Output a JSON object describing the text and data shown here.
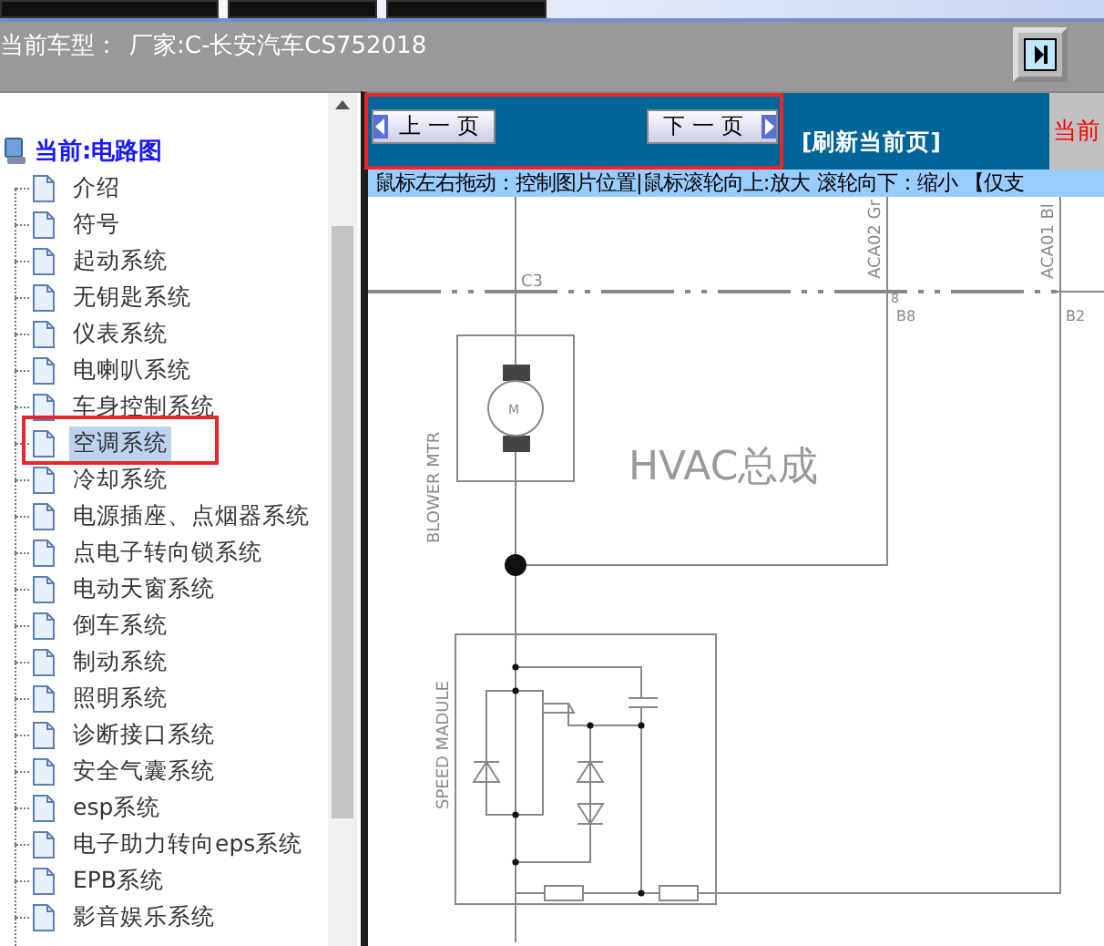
{
  "header": {
    "car_model_label": "当前车型：",
    "car_model_value": "厂家:C-长安汽车CS752018"
  },
  "tree": {
    "root": "当前:电路图",
    "items": [
      {
        "label": "介绍",
        "selected": false,
        "marked": false
      },
      {
        "label": "符号",
        "selected": false,
        "marked": false
      },
      {
        "label": "起动系统",
        "selected": false,
        "marked": false
      },
      {
        "label": "无钥匙系统",
        "selected": false,
        "marked": false
      },
      {
        "label": "仪表系统",
        "selected": false,
        "marked": false
      },
      {
        "label": "电喇叭系统",
        "selected": false,
        "marked": false
      },
      {
        "label": "车身控制系统",
        "selected": false,
        "marked": false
      },
      {
        "label": "空调系统",
        "selected": true,
        "marked": true
      },
      {
        "label": "冷却系统",
        "selected": false,
        "marked": false
      },
      {
        "label": "电源插座、点烟器系统",
        "selected": false,
        "marked": false
      },
      {
        "label": "点电子转向锁系统",
        "selected": false,
        "marked": false
      },
      {
        "label": "电动天窗系统",
        "selected": false,
        "marked": false
      },
      {
        "label": "倒车系统",
        "selected": false,
        "marked": false
      },
      {
        "label": "制动系统",
        "selected": false,
        "marked": false
      },
      {
        "label": "照明系统",
        "selected": false,
        "marked": false
      },
      {
        "label": "诊断接口系统",
        "selected": false,
        "marked": false
      },
      {
        "label": "安全气囊系统",
        "selected": false,
        "marked": false
      },
      {
        "label": "esp系统",
        "selected": false,
        "marked": false
      },
      {
        "label": "电子助力转向eps系统",
        "selected": false,
        "marked": false
      },
      {
        "label": "EPB系统",
        "selected": false,
        "marked": false
      },
      {
        "label": "影音娱乐系统",
        "selected": false,
        "marked": false
      }
    ]
  },
  "viewer": {
    "toolbar": {
      "marked": true,
      "prev_button": "上一页",
      "next_button": "下一页",
      "refresh_link": "[刷新当前页]",
      "status_text": "当前"
    },
    "hint": "鼠标左右拖动：控制图片位置|鼠标滚轮向上:放大  滚轮向下：缩小 【仅支",
    "diagram": {
      "title": "HVAC总成",
      "motor_label": "BLOWER MTR",
      "motor_symbol": "M",
      "module_label": "SPEED MADULE",
      "connector": "C3",
      "wire_left": "ACA02 Gr",
      "wire_right": "ACA01 Bl",
      "pin_8": "8",
      "pin_b8": "B8",
      "pin_b2": "B2"
    }
  }
}
